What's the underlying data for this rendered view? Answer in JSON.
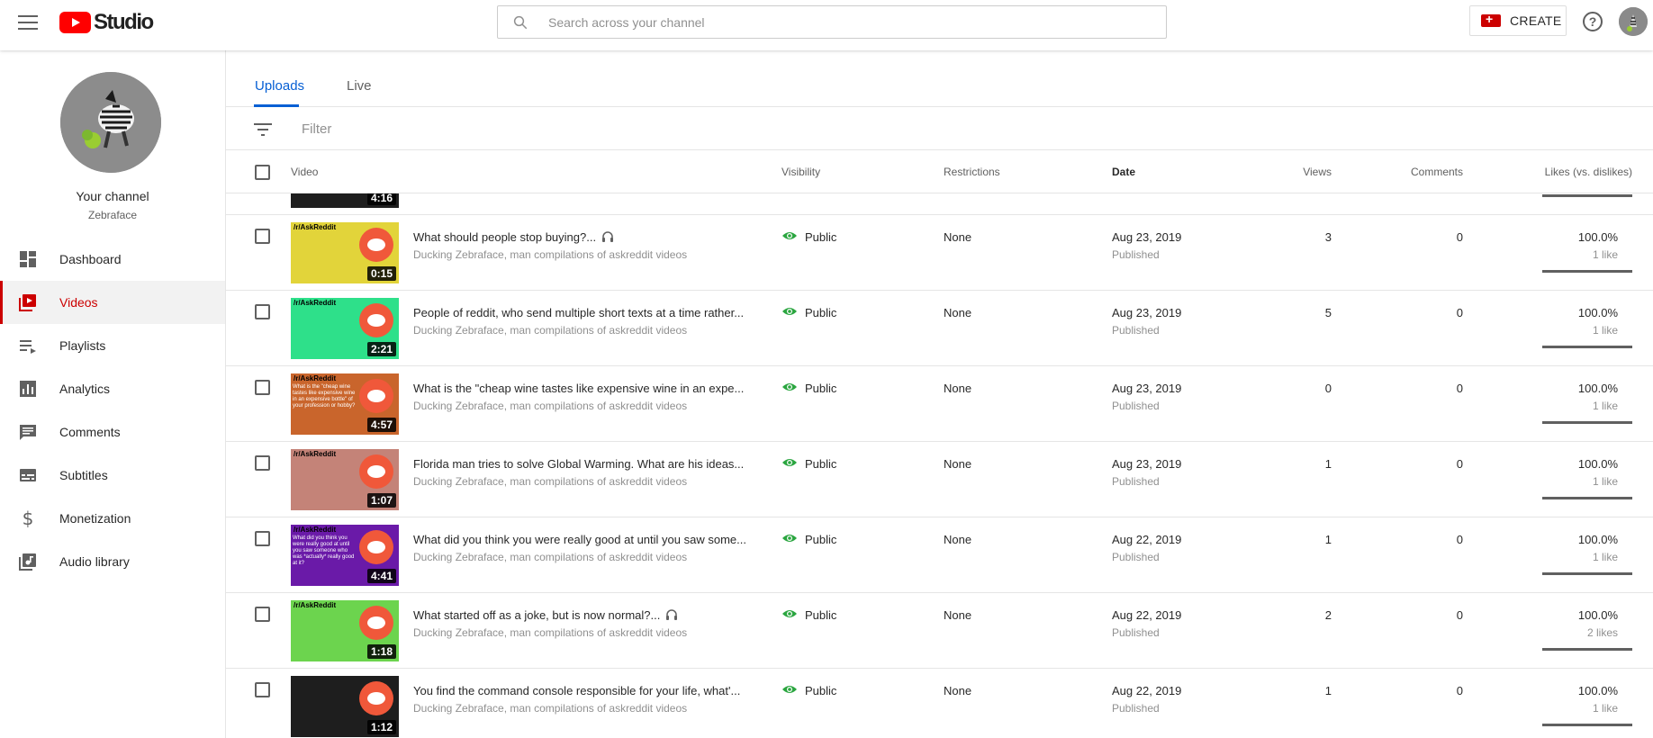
{
  "app": {
    "logo_text": "Studio",
    "search_placeholder": "Search across your channel",
    "create_label": "CREATE",
    "help_glyph": "?"
  },
  "sidebar": {
    "channel_title": "Your channel",
    "channel_name": "Zebraface",
    "items": [
      {
        "label": "Dashboard",
        "icon": "dashboard-icon",
        "active": false
      },
      {
        "label": "Videos",
        "icon": "videos-icon",
        "active": true
      },
      {
        "label": "Playlists",
        "icon": "playlists-icon",
        "active": false
      },
      {
        "label": "Analytics",
        "icon": "analytics-icon",
        "active": false
      },
      {
        "label": "Comments",
        "icon": "comments-icon",
        "active": false
      },
      {
        "label": "Subtitles",
        "icon": "subtitles-icon",
        "active": false
      },
      {
        "label": "Monetization",
        "icon": "monetization-icon",
        "active": false
      },
      {
        "label": "Audio library",
        "icon": "audio-library-icon",
        "active": false
      }
    ]
  },
  "tabs": [
    {
      "label": "Uploads",
      "active": true
    },
    {
      "label": "Live",
      "active": false
    }
  ],
  "filter_placeholder": "Filter",
  "table": {
    "columns": {
      "video": "Video",
      "visibility": "Visibility",
      "restrictions": "Restrictions",
      "date": "Date",
      "views": "Views",
      "comments": "Comments",
      "likes": "Likes (vs. dislikes)"
    },
    "partial_row_duration": "4:16",
    "rows": [
      {
        "title": "What should people stop buying?...",
        "desc": "Ducking Zebraface, man compilations of askreddit videos",
        "visibility": "Public",
        "restrictions": "None",
        "date": "Aug 23, 2019",
        "status": "Published",
        "views": "3",
        "comments": "0",
        "likes_pct": "100.0%",
        "likes_count": "1 like",
        "like_ratio": 1.0,
        "duration": "0:15",
        "thumb_color": "#e2d43a",
        "thumb_tag": "/r/AskReddit",
        "has_headset": true
      },
      {
        "title": "People of reddit, who send multiple short texts at a time rather...",
        "desc": "Ducking Zebraface, man compilations of askreddit videos",
        "visibility": "Public",
        "restrictions": "None",
        "date": "Aug 23, 2019",
        "status": "Published",
        "views": "5",
        "comments": "0",
        "likes_pct": "100.0%",
        "likes_count": "1 like",
        "like_ratio": 1.0,
        "duration": "2:21",
        "thumb_color": "#2ee08a",
        "thumb_tag": "/r/AskReddit",
        "has_headset": false
      },
      {
        "title": "What is the \"cheap wine tastes like expensive wine in an expe...",
        "desc": "Ducking Zebraface, man compilations of askreddit videos",
        "visibility": "Public",
        "restrictions": "None",
        "date": "Aug 23, 2019",
        "status": "Published",
        "views": "0",
        "comments": "0",
        "likes_pct": "100.0%",
        "likes_count": "1 like",
        "like_ratio": 1.0,
        "duration": "4:57",
        "thumb_color": "#c9652c",
        "thumb_tag": "/r/AskReddit",
        "thumb_text": "What is the \"cheap wine tastes like expensive wine in an expensive bottle\" of your profession or hobby?",
        "has_headset": false
      },
      {
        "title": "Florida man tries to solve Global Warming. What are his ideas...",
        "desc": "Ducking Zebraface, man compilations of askreddit videos",
        "visibility": "Public",
        "restrictions": "None",
        "date": "Aug 23, 2019",
        "status": "Published",
        "views": "1",
        "comments": "0",
        "likes_pct": "100.0%",
        "likes_count": "1 like",
        "like_ratio": 1.0,
        "duration": "1:07",
        "thumb_color": "#c48378",
        "thumb_tag": "/r/AskReddit",
        "has_headset": false
      },
      {
        "title": "What did you think you were really good at until you saw some...",
        "desc": "Ducking Zebraface, man compilations of askreddit videos",
        "visibility": "Public",
        "restrictions": "None",
        "date": "Aug 22, 2019",
        "status": "Published",
        "views": "1",
        "comments": "0",
        "likes_pct": "100.0%",
        "likes_count": "1 like",
        "like_ratio": 1.0,
        "duration": "4:41",
        "thumb_color": "#6a1aa8",
        "thumb_tag": "/r/AskReddit",
        "thumb_text": "What did you think you were really good at until you saw someone who was *actually* really good at it?",
        "has_headset": false
      },
      {
        "title": "What started off as a joke, but is now normal?...",
        "desc": "Ducking Zebraface, man compilations of askreddit videos",
        "visibility": "Public",
        "restrictions": "None",
        "date": "Aug 22, 2019",
        "status": "Published",
        "views": "2",
        "comments": "0",
        "likes_pct": "100.0%",
        "likes_count": "2 likes",
        "like_ratio": 1.0,
        "duration": "1:18",
        "thumb_color": "#6cd44e",
        "thumb_tag": "/r/AskReddit",
        "has_headset": true
      },
      {
        "title": "You find the command console responsible for your life, what'...",
        "desc": "Ducking Zebraface, man compilations of askreddit videos",
        "visibility": "Public",
        "restrictions": "None",
        "date": "Aug 22, 2019",
        "status": "Published",
        "views": "1",
        "comments": "0",
        "likes_pct": "100.0%",
        "likes_count": "1 like",
        "like_ratio": 1.0,
        "duration": "1:12",
        "thumb_color": "#1e1e1e",
        "thumb_tag": "",
        "has_headset": false
      }
    ]
  },
  "colors": {
    "accent_blue": "#065fd4",
    "brand_red": "#cc0000",
    "public_green": "#2ba640"
  }
}
